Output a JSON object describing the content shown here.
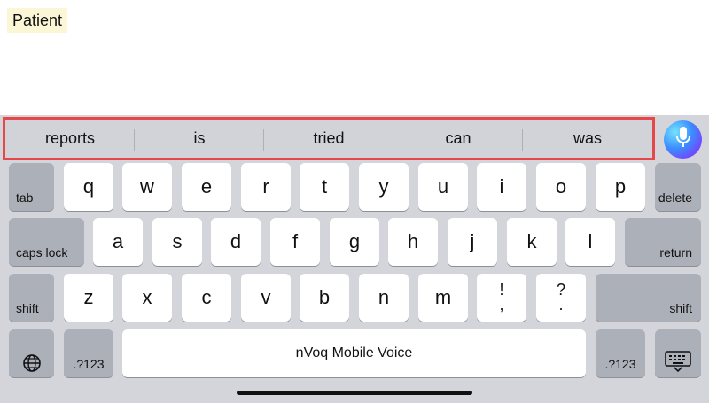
{
  "document": {
    "text": "Patient"
  },
  "suggestions": [
    "reports",
    "is",
    "tried",
    "can",
    "was"
  ],
  "rows": {
    "row1": [
      "q",
      "w",
      "e",
      "r",
      "t",
      "y",
      "u",
      "i",
      "o",
      "p"
    ],
    "row2": [
      "a",
      "s",
      "d",
      "f",
      "g",
      "h",
      "j",
      "k",
      "l"
    ],
    "row3": [
      "z",
      "x",
      "c",
      "v",
      "b",
      "n",
      "m"
    ]
  },
  "punct": {
    "exclam_top": "!",
    "comma": ",",
    "question_top": "?",
    "period": "."
  },
  "labels": {
    "tab": "tab",
    "delete": "delete",
    "caps_lock": "caps lock",
    "return": "return",
    "shift_left": "shift",
    "shift_right": "shift",
    "numbers_left": ".?123",
    "numbers_right": ".?123",
    "space": "nVoq Mobile Voice"
  },
  "icons": {
    "mic": "microphone-icon",
    "globe": "globe-icon",
    "hide_keyboard": "keyboard-hide-icon"
  }
}
